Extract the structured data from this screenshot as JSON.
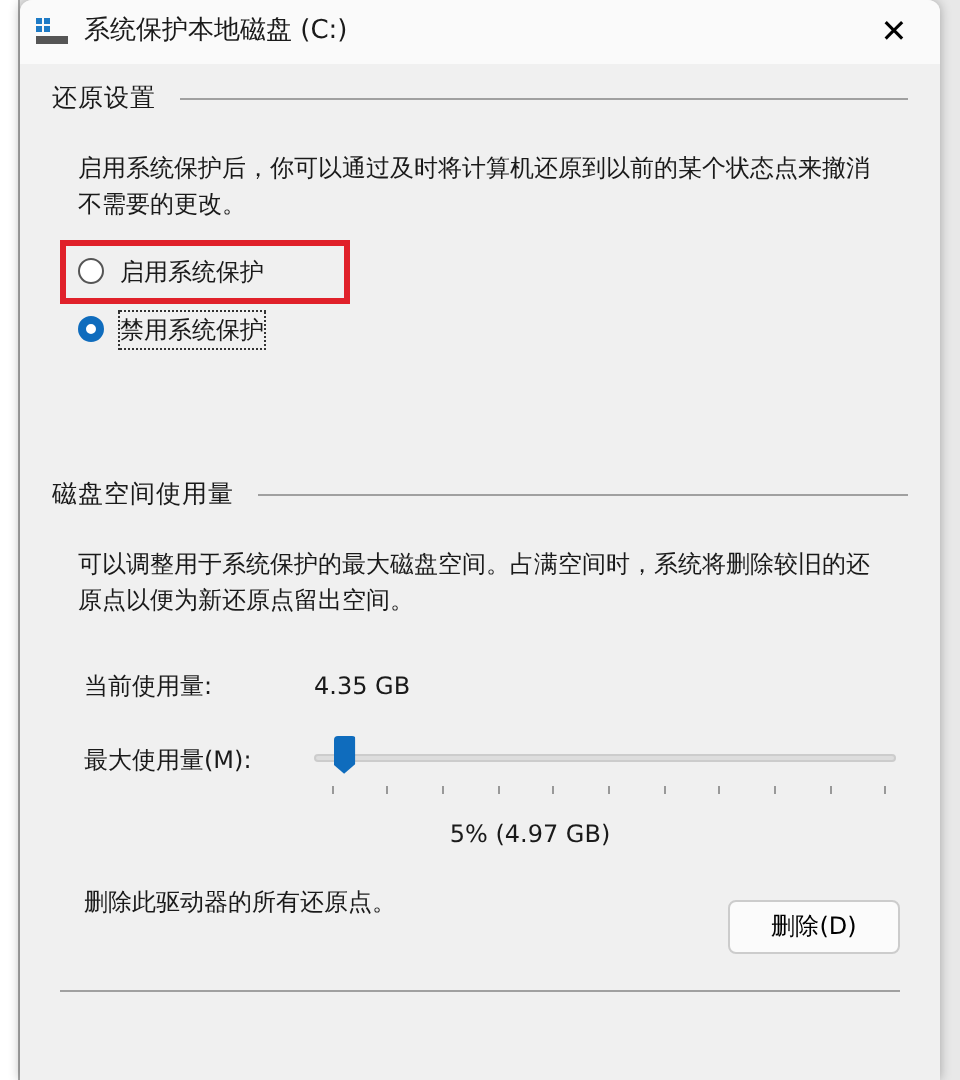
{
  "window": {
    "title": "系统保护本地磁盘 (C:)",
    "close": "✕"
  },
  "restore_settings": {
    "heading": "还原设置",
    "description": "启用系统保护后，你可以通过及时将计算机还原到以前的某个状态点来撤消不需要的更改。",
    "options": [
      {
        "label": "启用系统保护",
        "selected": false,
        "highlighted": true
      },
      {
        "label": "禁用系统保护",
        "selected": true,
        "highlighted": false
      }
    ]
  },
  "disk_usage": {
    "heading": "磁盘空间使用量",
    "description": "可以调整用于系统保护的最大磁盘空间。占满空间时，系统将删除较旧的还原点以便为新还原点留出空间。",
    "current_label": "当前使用量:",
    "current_value": "4.35 GB",
    "max_label": "最大使用量(M):",
    "slider": {
      "level": 0.05
    },
    "max_reading": "5% (4.97 GB)",
    "delete_text": "删除此驱动器的所有还原点。",
    "delete_button": "删除(D)"
  }
}
